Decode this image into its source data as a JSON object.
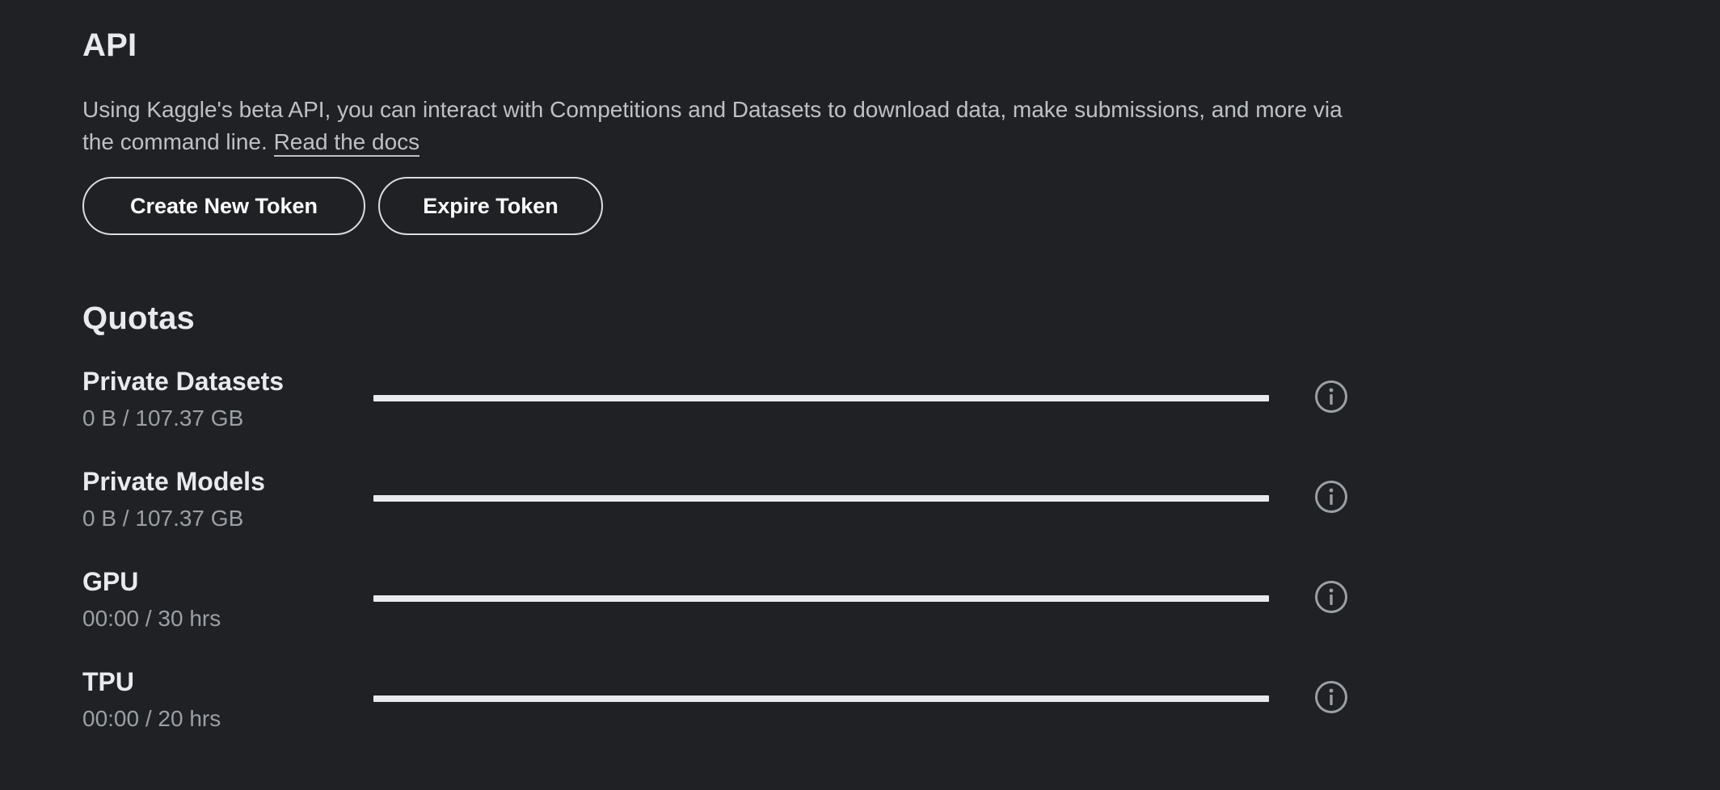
{
  "api": {
    "title": "API",
    "description": "Using Kaggle's beta API, you can interact with Competitions and Datasets to download data, make submissions, and more via the command line.",
    "docs_link": "Read the docs",
    "create_button": "Create New Token",
    "expire_button": "Expire Token"
  },
  "quotas": {
    "title": "Quotas",
    "items": [
      {
        "name": "Private Datasets",
        "usage": "0 B / 107.37 GB",
        "fraction": 0
      },
      {
        "name": "Private Models",
        "usage": "0 B / 107.37 GB",
        "fraction": 0
      },
      {
        "name": "GPU",
        "usage": "00:00 / 30 hrs",
        "fraction": 0
      },
      {
        "name": "TPU",
        "usage": "00:00 / 20 hrs",
        "fraction": 0
      }
    ],
    "info_icon": "info-icon"
  },
  "colors": {
    "background": "#202124",
    "text": "#e8eaed",
    "muted_text": "#9aa0a6",
    "bar_track": "#e8eaed"
  }
}
